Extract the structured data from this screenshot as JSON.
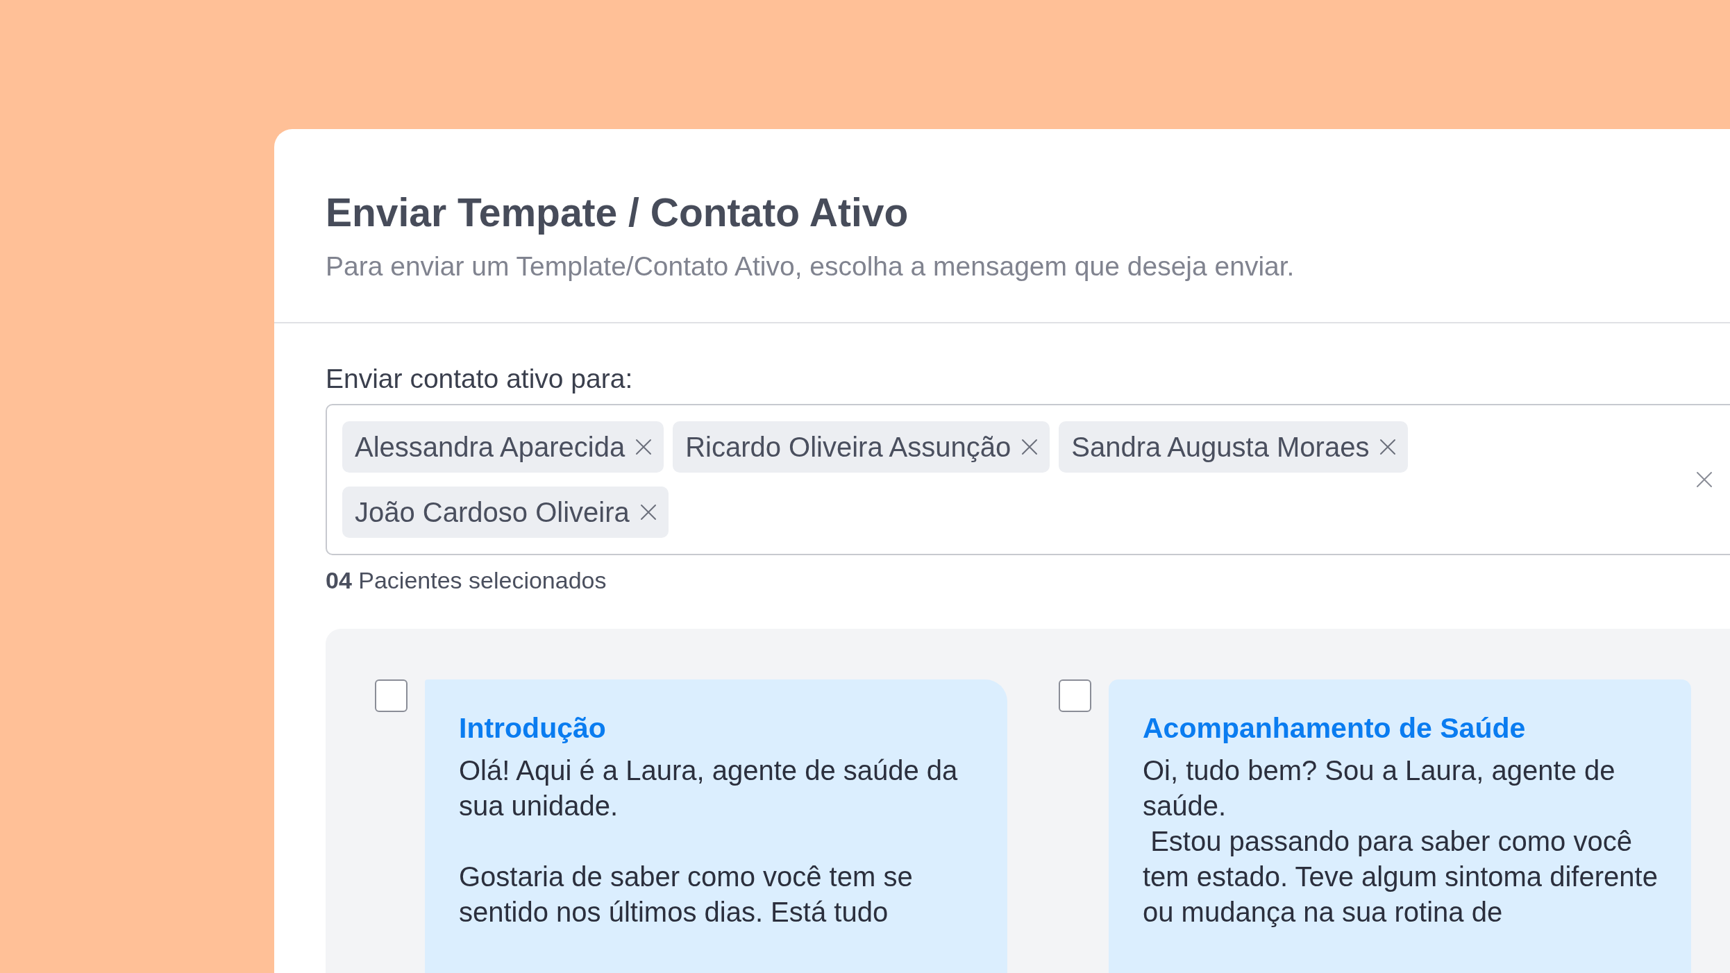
{
  "dialog": {
    "title": "Enviar Tempate / Contato Ativo",
    "subtitle": "Para enviar um Template/Contato Ativo, escolha a mensagem que deseja enviar."
  },
  "recipients": {
    "label": "Enviar contato ativo para:",
    "chips": [
      {
        "name": "Alessandra Aparecida"
      },
      {
        "name": "Ricardo Oliveira Assunção"
      },
      {
        "name": "Sandra Augusta Moraes"
      },
      {
        "name": "João Cardoso Oliveira"
      }
    ],
    "count": "**04** Pacientes selecionados"
  },
  "templates": [
    {
      "title": "Introdução",
      "body": "Olá! Aqui é a Laura, agente de saúde da sua unidade.\n\nGostaria de saber como você tem se sentido nos últimos dias. Está tudo",
      "checked": false
    },
    {
      "title": "Acompanhamento de Saúde",
      "body": "Oi, tudo bem? Sou a Laura, agente de saúde.\n Estou passando para saber como você tem estado. Teve algum sintoma diferente ou mudança na sua rotina de",
      "checked": false
    }
  ]
}
